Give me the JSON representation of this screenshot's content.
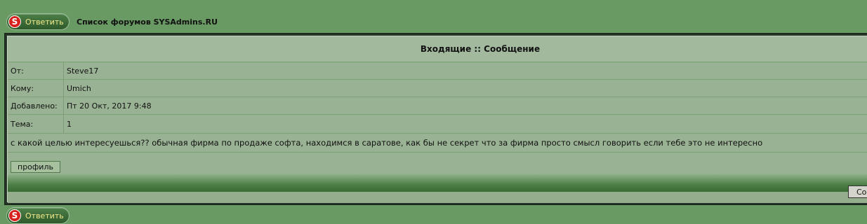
{
  "reply_button": {
    "label": "Ответить",
    "logo_letter": "S"
  },
  "forum_link": "Список форумов SYSAdmins.RU",
  "message": {
    "header": "Входящие :: Сообщение",
    "fields": [
      {
        "label": "От:",
        "value": "Steve17"
      },
      {
        "label": "Кому:",
        "value": "Umich"
      },
      {
        "label": "Добавлено:",
        "value": "Пт 20 Окт, 2017 9:48"
      },
      {
        "label": "Тема:",
        "value": "1"
      }
    ],
    "body": "с какой целью интересуешься?? обычная фирма по продаже софта, находимся в саратове, как бы не секрет что за фирма просто смысл говорить если тебе это не интересно",
    "profile_button": "профиль",
    "partial_button": "Со"
  },
  "colors": {
    "page_bg": "#6a9a63",
    "table_bg": "#9ab294",
    "reply_text": "#f4e98a",
    "logo_red": "#d8201f"
  }
}
